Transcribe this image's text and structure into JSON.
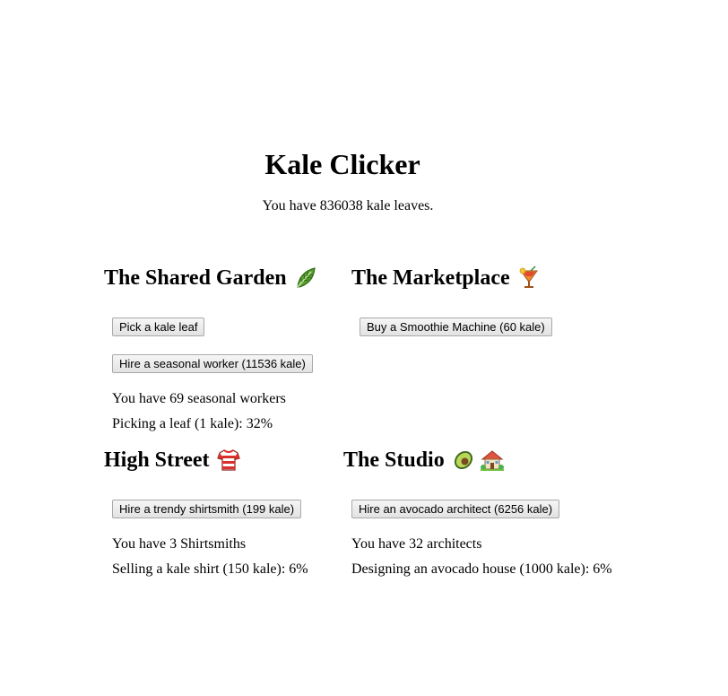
{
  "header": {
    "title": "Kale Clicker",
    "kale_status": "You have 836038 kale leaves."
  },
  "garden": {
    "title": "The Shared Garden",
    "icon": "kale-leaf-icon",
    "pick_button": "Pick a kale leaf",
    "hire_button": "Hire a seasonal worker (11536 kale)",
    "workers_text": "You have 69 seasonal workers",
    "progress_text": "Picking a leaf (1 kale): 32%"
  },
  "marketplace": {
    "title": "The Marketplace",
    "icon": "tropical-drink-icon",
    "buy_button": "Buy a Smoothie Machine (60 kale)"
  },
  "high_street": {
    "title": "High Street",
    "icon": "shirt-icon",
    "hire_button": "Hire a trendy shirtsmith (199 kale)",
    "count_text": "You have 3 Shirtsmiths",
    "progress_text": "Selling a kale shirt (150 kale): 6%"
  },
  "studio": {
    "title": "The Studio",
    "icons": [
      "avocado-icon",
      "house-with-garden-icon"
    ],
    "hire_button": "Hire an avocado architect (6256 kale)",
    "count_text": "You have 32 architects",
    "progress_text": "Designing an avocado house (1000 kale): 6%"
  },
  "colors": {
    "leaf_green": "#5a9e2f",
    "shirt_red": "#d9302c",
    "avocado_green": "#7cab3a",
    "house_roof": "#e0553f"
  }
}
